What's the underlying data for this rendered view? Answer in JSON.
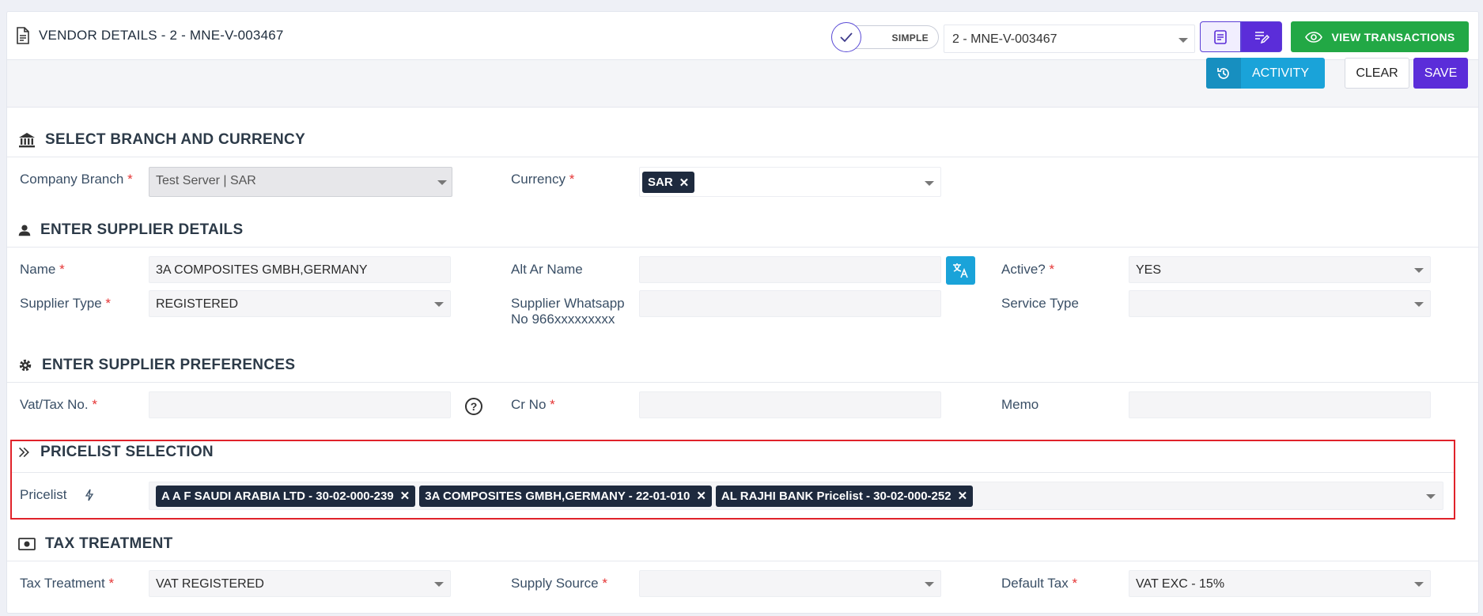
{
  "header": {
    "title": "VENDOR DETAILS - 2 - MNE-V-003467",
    "toggle_label": "SIMPLE",
    "record_select": "2 - MNE-V-003467",
    "view_transactions": "VIEW TRANSACTIONS"
  },
  "toolbar": {
    "activity": "ACTIVITY",
    "clear": "CLEAR",
    "save": "SAVE"
  },
  "sections": {
    "branch": "SELECT BRANCH AND CURRENCY",
    "supplier": "ENTER SUPPLIER DETAILS",
    "preferences": "ENTER SUPPLIER PREFERENCES",
    "pricelist": "PRICELIST SELECTION",
    "tax": "TAX TREATMENT"
  },
  "labels": {
    "company_branch": "Company Branch",
    "currency": "Currency",
    "name": "Name",
    "alt_ar_name": "Alt Ar Name",
    "active": "Active?",
    "supplier_type": "Supplier Type",
    "supplier_whatsapp_1": "Supplier Whatsapp",
    "supplier_whatsapp_2": "No 966xxxxxxxxx",
    "service_type": "Service Type",
    "vat_tax_no": "Vat/Tax No.",
    "cr_no": "Cr No",
    "memo": "Memo",
    "pricelist": "Pricelist",
    "tax_treatment": "Tax Treatment",
    "supply_source": "Supply Source",
    "default_tax": "Default Tax",
    "required_mark": "*"
  },
  "values": {
    "company_branch": "Test Server | SAR",
    "currency_tag": "SAR",
    "name": "3A COMPOSITES GMBH,GERMANY",
    "alt_ar_name": "",
    "active": "YES",
    "supplier_type": "REGISTERED",
    "supplier_whatsapp": "",
    "service_type": "",
    "vat_tax_no": "",
    "cr_no": "",
    "memo": "",
    "pricelist_tags": [
      "A A F SAUDI ARABIA LTD - 30-02-000-239",
      "3A COMPOSITES GMBH,GERMANY - 22-01-010",
      "AL RAJHI BANK Pricelist - 30-02-000-252"
    ],
    "tax_treatment": "VAT REGISTERED",
    "supply_source": "",
    "default_tax": "VAT EXC - 15%",
    "remove_glyph": "✕",
    "help_glyph": "?"
  },
  "icons": {
    "title": "document-icon",
    "bank": "bank-icon",
    "user": "user-icon",
    "gear": "gear-icon",
    "chevrons": "double-chevron-icon",
    "money": "money-icon",
    "history": "history-icon",
    "translate": "translate-icon",
    "help": "help-circle-icon",
    "bolt": "lightning-icon",
    "eye": "eye-icon"
  },
  "colors": {
    "accent": "#5b2dd9",
    "success": "#22a845",
    "info": "#1aa3d9",
    "required": "#e53535",
    "highlight": "#e0222a"
  }
}
